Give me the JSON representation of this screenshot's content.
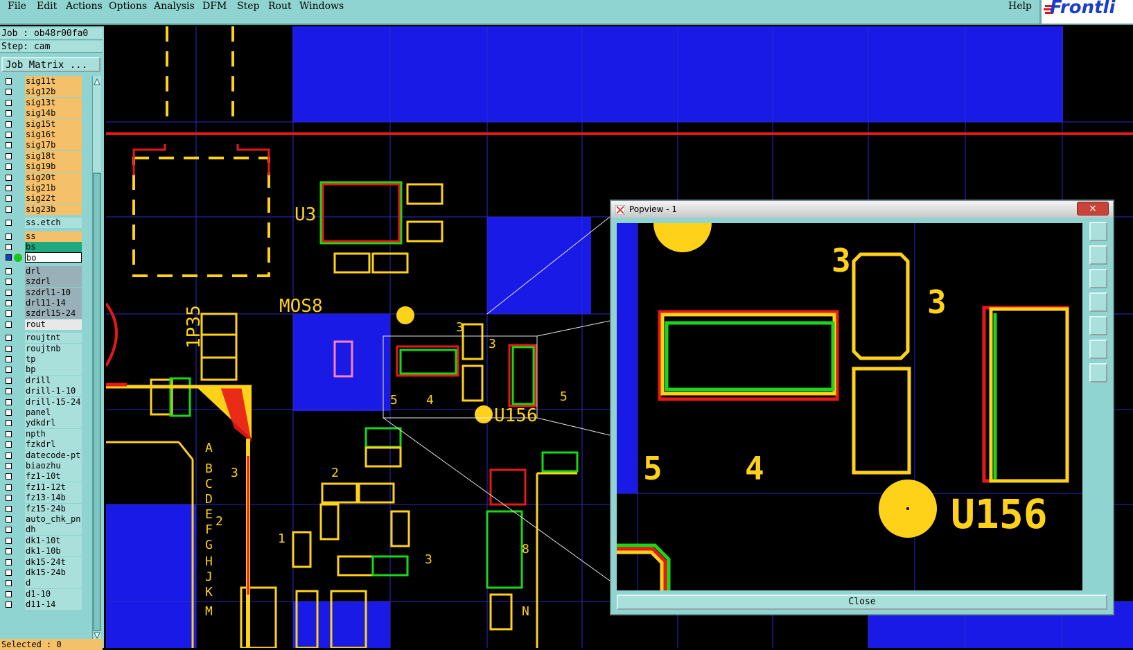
{
  "menu": {
    "items": [
      "File",
      "Edit",
      "Actions",
      "Options",
      "Analysis",
      "DFM",
      "Step",
      "Rout",
      "Windows"
    ],
    "help": "Help"
  },
  "logo": {
    "text": "Frontli"
  },
  "job": {
    "job_line": "Job : ob48r00fa0",
    "step_line": "Step: cam",
    "matrix_button": "Job Matrix ..."
  },
  "layers": [
    {
      "name": "sig11t",
      "color": "#f5c06a",
      "sel": false
    },
    {
      "name": "sig12b",
      "color": "#f5c06a",
      "sel": false
    },
    {
      "name": "sig13t",
      "color": "#f5c06a",
      "sel": false
    },
    {
      "name": "sig14b",
      "color": "#f5c06a",
      "sel": false
    },
    {
      "name": "sig15t",
      "color": "#f5c06a",
      "sel": false
    },
    {
      "name": "sig16t",
      "color": "#f5c06a",
      "sel": false
    },
    {
      "name": "sig17b",
      "color": "#f5c06a",
      "sel": false
    },
    {
      "name": "sig18t",
      "color": "#f5c06a",
      "sel": false
    },
    {
      "name": "sig19b",
      "color": "#f5c06a",
      "sel": false
    },
    {
      "name": "sig20t",
      "color": "#f5c06a",
      "sel": false
    },
    {
      "name": "sig21b",
      "color": "#f5c06a",
      "sel": false
    },
    {
      "name": "sig22t",
      "color": "#f5c06a",
      "sel": false
    },
    {
      "name": "sig23b",
      "color": "#f5c06a",
      "sel": false
    },
    {
      "name": "ss.etch",
      "color": "#a9e0dc",
      "sel": false,
      "gap": true
    },
    {
      "name": "ss",
      "color": "#f5c06a",
      "sel": false,
      "gap": true
    },
    {
      "name": "bs",
      "color": "#20a880",
      "sel": false
    },
    {
      "name": "bo",
      "color": "#ffffff",
      "sel": true
    },
    {
      "name": "drl",
      "color": "#9ab0b8",
      "sel": false,
      "gap": true
    },
    {
      "name": "szdrl",
      "color": "#9ab0b8",
      "sel": false
    },
    {
      "name": "szdrl1-10",
      "color": "#9ab0b8",
      "sel": false
    },
    {
      "name": "drl11-14",
      "color": "#9ab0b8",
      "sel": false
    },
    {
      "name": "szdrl15-24",
      "color": "#9ab0b8",
      "sel": false
    },
    {
      "name": "rout",
      "color": "#e8e8e8",
      "sel": false
    },
    {
      "name": "roujtnt",
      "color": "#a9e0dc",
      "sel": false,
      "gap": true
    },
    {
      "name": "roujtnb",
      "color": "#a9e0dc",
      "sel": false
    },
    {
      "name": "tp",
      "color": "#a9e0dc",
      "sel": false
    },
    {
      "name": "bp",
      "color": "#a9e0dc",
      "sel": false
    },
    {
      "name": "drill",
      "color": "#a9e0dc",
      "sel": false
    },
    {
      "name": "drill-1-10",
      "color": "#a9e0dc",
      "sel": false
    },
    {
      "name": "drill-15-24",
      "color": "#a9e0dc",
      "sel": false
    },
    {
      "name": "panel",
      "color": "#a9e0dc",
      "sel": false
    },
    {
      "name": "ydkdrl",
      "color": "#a9e0dc",
      "sel": false
    },
    {
      "name": "npth",
      "color": "#a9e0dc",
      "sel": false
    },
    {
      "name": "fzkdrl",
      "color": "#a9e0dc",
      "sel": false
    },
    {
      "name": "datecode-pt",
      "color": "#a9e0dc",
      "sel": false
    },
    {
      "name": "biaozhu",
      "color": "#a9e0dc",
      "sel": false
    },
    {
      "name": "fz1-10t",
      "color": "#a9e0dc",
      "sel": false
    },
    {
      "name": "fz11-12t",
      "color": "#a9e0dc",
      "sel": false
    },
    {
      "name": "fz13-14b",
      "color": "#a9e0dc",
      "sel": false
    },
    {
      "name": "fz15-24b",
      "color": "#a9e0dc",
      "sel": false
    },
    {
      "name": "auto_chk_pn",
      "color": "#a9e0dc",
      "sel": false
    },
    {
      "name": "dh",
      "color": "#a9e0dc",
      "sel": false
    },
    {
      "name": "dk1-10t",
      "color": "#a9e0dc",
      "sel": false
    },
    {
      "name": "dk1-10b",
      "color": "#a9e0dc",
      "sel": false
    },
    {
      "name": "dk15-24t",
      "color": "#a9e0dc",
      "sel": false
    },
    {
      "name": "dk15-24b",
      "color": "#a9e0dc",
      "sel": false
    },
    {
      "name": "d",
      "color": "#a9e0dc",
      "sel": false
    },
    {
      "name": "d1-10",
      "color": "#a9e0dc",
      "sel": false
    },
    {
      "name": "d11-14",
      "color": "#a9e0dc",
      "sel": false
    }
  ],
  "status": {
    "selected": "Selected : 0"
  },
  "canvas_labels": {
    "u3": "U3",
    "mos8": "MOS8",
    "lp35": "1P35",
    "u156": "U156",
    "n3a": "3",
    "n3b": "3",
    "n4": "4",
    "n5a": "5",
    "n5b": "5",
    "a": "A",
    "b": "B",
    "c": "C",
    "d": "D",
    "e": "E",
    "f": "F",
    "g": "G",
    "h": "H",
    "j": "J",
    "k": "K",
    "m": "M",
    "n2a": "2",
    "n2b": "2",
    "n3c": "3",
    "n1": "1",
    "n3d": "3",
    "n8": "8",
    "nn": "N"
  },
  "popup": {
    "title": "Popview - 1",
    "close_x": "×",
    "close_button": "Close",
    "labels": {
      "p3a": "3",
      "p3b": "3",
      "p5": "5",
      "p4": "4",
      "pu156": "U156"
    }
  },
  "colors": {
    "board_blue": "#1a1ae6",
    "grid": "#2a2ad0",
    "pad_yellow": "#ffd21a",
    "red": "#e81818",
    "green": "#18d818",
    "teal": "#8fd4d0"
  }
}
